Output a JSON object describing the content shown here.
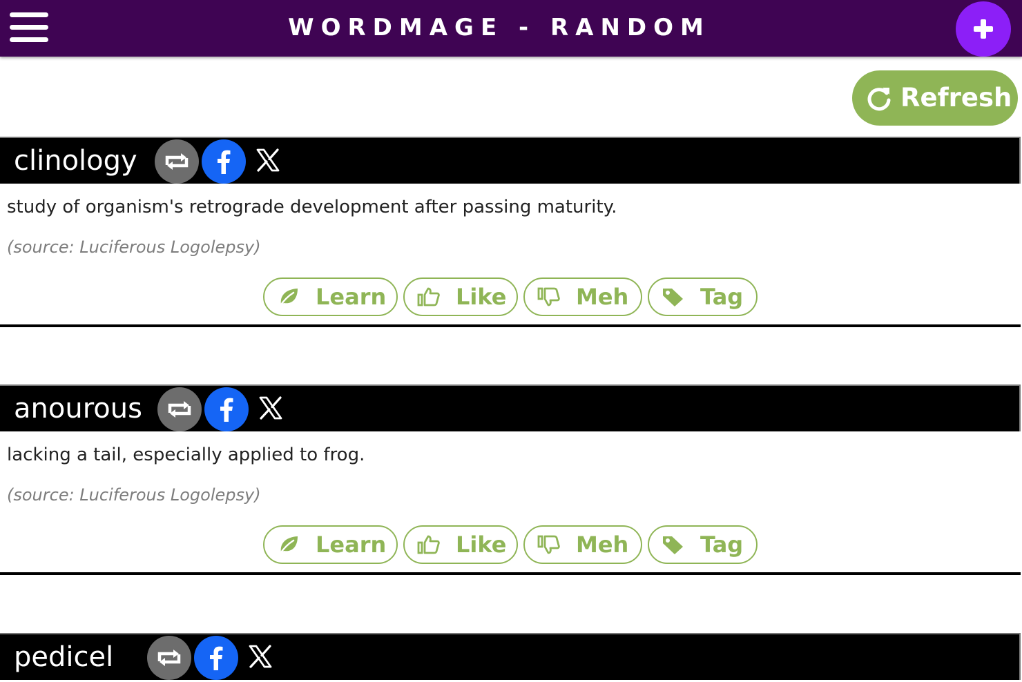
{
  "header": {
    "title": "WORDMAGE - RANDOM",
    "menu_icon": "hamburger-menu-icon",
    "add_icon": "plus-icon",
    "background_color": "#3f0453",
    "add_button_color": "#8c1ff7"
  },
  "refresh": {
    "label": "Refresh",
    "icon": "refresh-icon",
    "color": "#8fb556"
  },
  "actions": {
    "learn": "Learn",
    "like": "Like",
    "meh": "Meh",
    "tag": "Tag",
    "learn_icon": "leaf-icon",
    "like_icon": "thumbs-up-icon",
    "meh_icon": "thumbs-down-icon",
    "tag_icon": "tag-icon"
  },
  "share_icons": {
    "repost": "repost-icon",
    "facebook": "facebook-icon",
    "x": "x-icon"
  },
  "words": [
    {
      "word": "clinology",
      "definition": "study of organism's retrograde development after passing maturity.",
      "source": "(source: Luciferous Logolepsy)"
    },
    {
      "word": "anourous",
      "definition": "lacking a tail, especially applied to frog.",
      "source": "(source: Luciferous Logolepsy)"
    },
    {
      "word": "pedicel"
    }
  ]
}
